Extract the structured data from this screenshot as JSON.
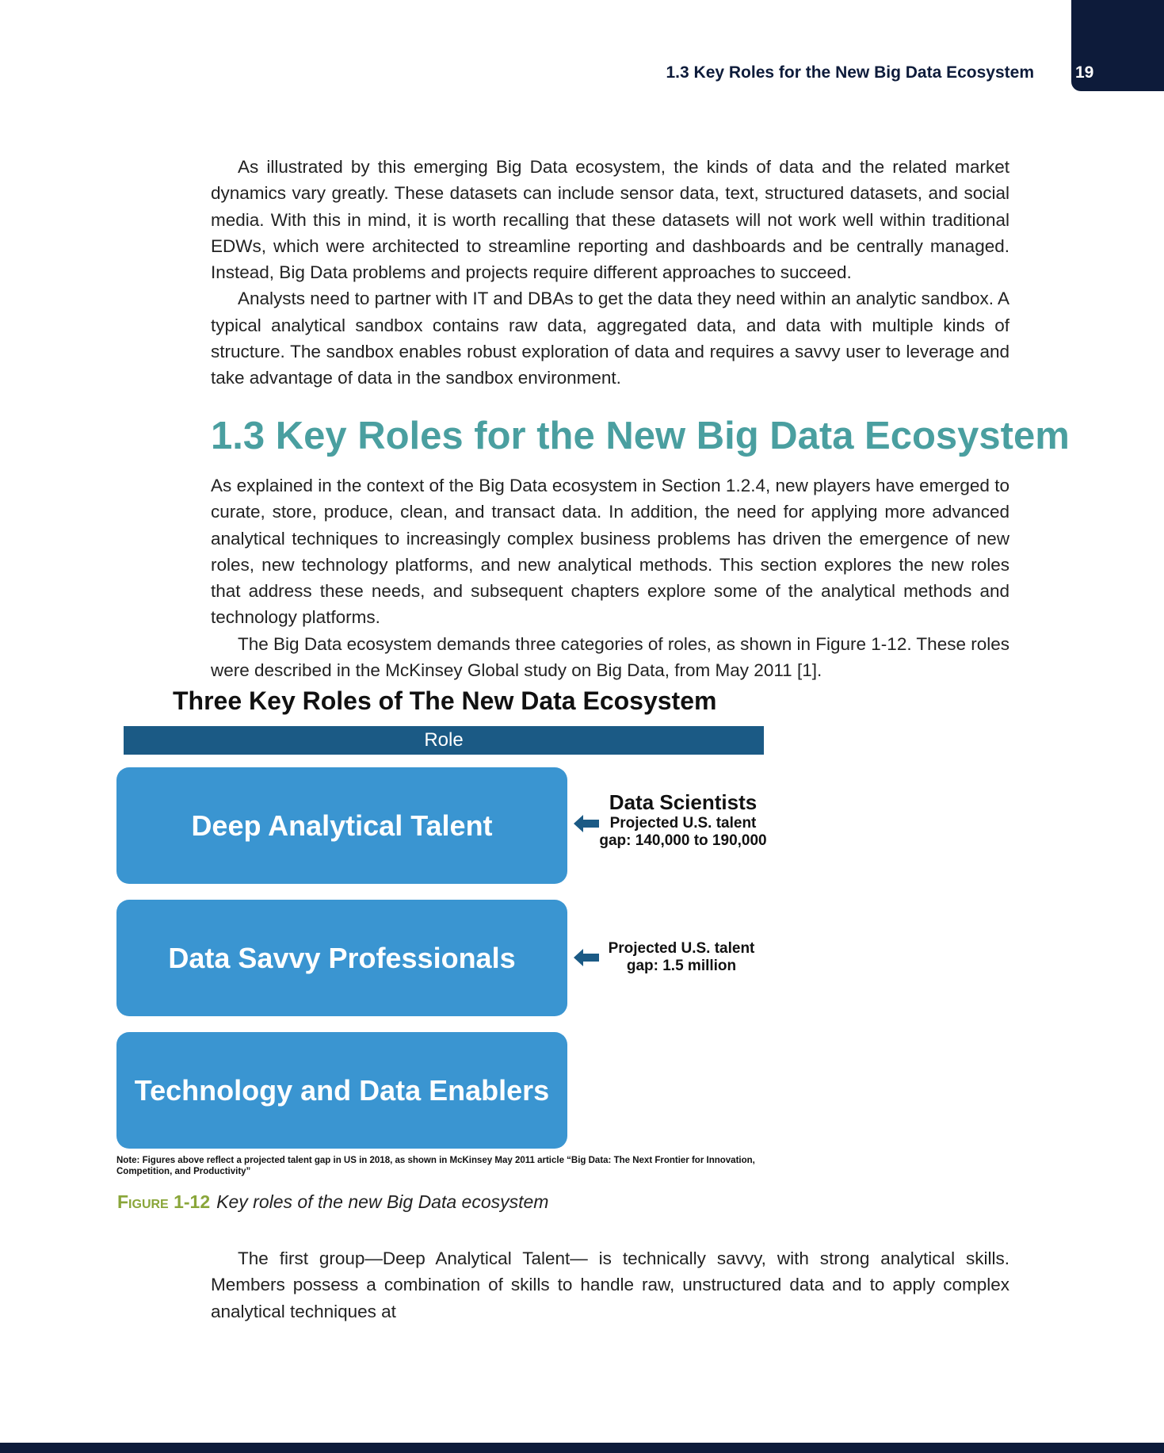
{
  "header": {
    "running_head": "1.3 Key Roles for the New Big Data Ecosystem",
    "page_number": "19"
  },
  "intro_paragraphs": [
    "As illustrated by this emerging Big Data ecosystem, the kinds of data and the related market dynamics vary greatly. These datasets can include sensor data, text, structured datasets, and social media. With this in mind, it is worth recalling that these datasets will not work well within traditional EDWs, which were architected to streamline reporting and dashboards and be centrally managed. Instead, Big Data problems and projects require different approaches to succeed.",
    "Analysts need to partner with IT and DBAs to get the data they need within an analytic sandbox. A typical analytical sandbox contains raw data, aggregated data, and data with multiple kinds of structure. The sandbox enables robust exploration of data and requires a savvy user to leverage and take advantage of data in the sandbox environment."
  ],
  "section": {
    "heading": "1.3 Key Roles for the New Big Data Ecosystem",
    "paragraphs": [
      "As explained in the context of the Big Data ecosystem in Section 1.2.4, new players have emerged to curate, store, produce, clean, and transact data. In addition, the need for applying more advanced analytical techniques to increasingly complex business problems has driven the emergence of new roles, new technology platforms, and new analytical methods. This section explores the new roles that address these needs, and subsequent chapters explore some of the analytical methods and technology platforms.",
      "The Big Data ecosystem demands three categories of roles, as shown in Figure 1-12. These roles were described in the McKinsey Global study on Big Data, from May 2011 [1]."
    ]
  },
  "figure": {
    "title": "Three Key Roles of The New Data Ecosystem",
    "role_header": "Role",
    "roles": [
      {
        "label": "Deep Analytical Talent",
        "callout_title": "Data Scientists",
        "callout_line1": "Projected U.S. talent",
        "callout_line2": "gap: 140,000 to 190,000"
      },
      {
        "label": "Data Savvy Professionals",
        "callout_title": "",
        "callout_line1": "Projected U.S. talent",
        "callout_line2": "gap: 1.5 million"
      },
      {
        "label": "Technology and Data Enablers"
      }
    ],
    "note": "Note: Figures above reflect a projected talent gap in US in 2018, as shown in McKinsey May 2011 article “Big Data: The Next Frontier for Innovation, Competition, and Productivity”",
    "caption_label": "Figure 1-12",
    "caption_text": "Key roles of the new Big Data ecosystem",
    "arrow_color": "#1b5a85",
    "box_color": "#3a95d1"
  },
  "closing_paragraph": "The first group—Deep Analytical Talent— is technically savvy, with strong analytical skills. Members possess a combination of skills to handle raw, unstructured data and to apply complex analytical techniques at"
}
